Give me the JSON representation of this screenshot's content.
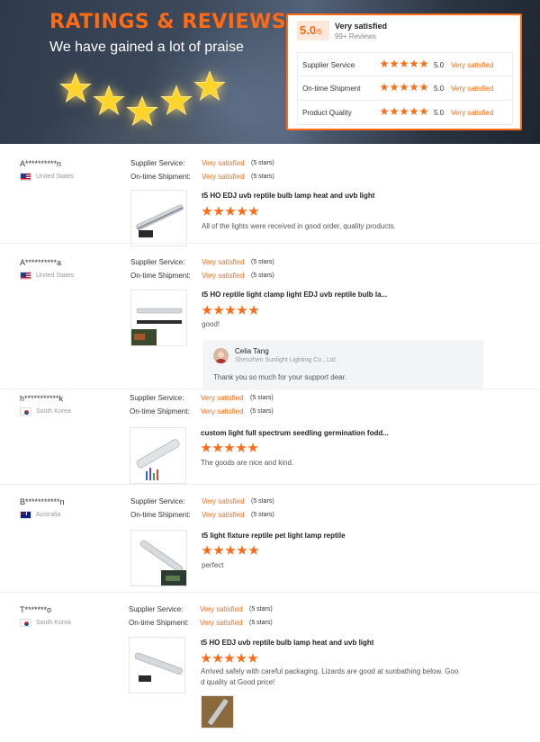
{
  "hero": {
    "title": "RATINGS & REVIEWS",
    "subtitle": "We have gained a lot of praise",
    "star_icon": "glowing-star-icon"
  },
  "summary": {
    "score": "5.0",
    "score_suffix": "/5",
    "satisfaction": "Very satisfied",
    "review_count": "99+ Reviews",
    "rows": [
      {
        "label": "Supplier Service",
        "rating": 5,
        "score": "5.0",
        "satisfaction": "Very satisfied"
      },
      {
        "label": "On-time Shipment",
        "rating": 5,
        "score": "5.0",
        "satisfaction": "Very satisfied"
      },
      {
        "label": "Product Quality",
        "rating": 5,
        "score": "5.0",
        "satisfaction": "Very satisfied"
      }
    ]
  },
  "labels": {
    "supplier_service": "Supplier Service:",
    "on_time_shipment": "On-time Shipment:"
  },
  "reviews": [
    {
      "user": "A**********n",
      "country": "United States",
      "flag": "us-flag-icon",
      "supplier_service": "Very satisfied",
      "supplier_service_stars": "(5 stars)",
      "on_time_shipment": "Very satisfied",
      "on_time_shipment_stars": "(5 stars)",
      "product": "t5 HO EDJ uvb reptile bulb lamp heat and uvb light",
      "rating": 5,
      "text": "All of the lights were received in good order, quality products."
    },
    {
      "user": "A**********a",
      "country": "United States",
      "flag": "us-flag-icon",
      "supplier_service": "Very satisfied",
      "supplier_service_stars": "(5 stars)",
      "on_time_shipment": "Very satisfied",
      "on_time_shipment_stars": "(5 stars)",
      "product": "t5 HO reptile light clamp light EDJ uvb reptile bulb la...",
      "rating": 5,
      "text": "good!",
      "reply": {
        "name": "Celia Tang",
        "company": "Shenzhen Sunlight Lighting Co., Ltd.",
        "text": "Thank you so much for your support dear."
      }
    },
    {
      "user": "h***********k",
      "country": "South Korea",
      "flag": "kr-flag-icon",
      "supplier_service": "Very satisfied",
      "supplier_service_stars": "(5 stars)",
      "on_time_shipment": "Very satisfied",
      "on_time_shipment_stars": "(5 stars)",
      "product": "custom light full spectrum seedling germination fodd...",
      "rating": 5,
      "text": "The goods are nice and kind."
    },
    {
      "user": "B***********n",
      "country": "Australia",
      "flag": "au-flag-icon",
      "supplier_service": "Very satisfied",
      "supplier_service_stars": "(5 stars)",
      "on_time_shipment": "Very satisfied",
      "on_time_shipment_stars": "(5 stars)",
      "product": "t5 light fixture reptile pet light lamp reptile",
      "rating": 5,
      "text": "perfect"
    },
    {
      "user": "T*******o",
      "country": "South Korea",
      "flag": "kr-flag-icon",
      "supplier_service": "Very satisfied",
      "supplier_service_stars": "(5 stars)",
      "on_time_shipment": "Very satisfied",
      "on_time_shipment_stars": "(5 stars)",
      "product": "t5 HO EDJ uvb reptile bulb lamp heat and uvb light",
      "rating": 5,
      "text_line1": "Arrived safely with careful packaging. Lizards are good at sunbathing below. Goo",
      "text_line2": "d quality at Good price!"
    }
  ],
  "colors": {
    "accent": "#ff6a14",
    "text": "#333333",
    "muted": "#999999",
    "reply_bg": "#f3f4f6"
  }
}
